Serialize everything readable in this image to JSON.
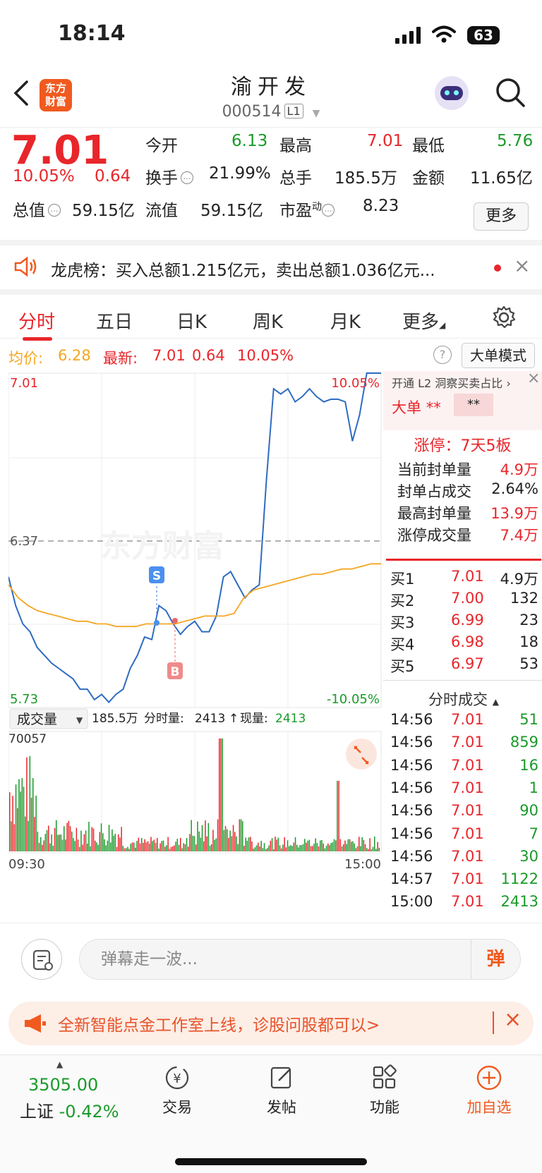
{
  "status_bar": {
    "time": "18:14",
    "battery": "63"
  },
  "header": {
    "logo_line1": "东方",
    "logo_line2": "财富",
    "stock_name": "渝开发",
    "stock_code": "000514",
    "level_badge": "L1"
  },
  "quote": {
    "price": "7.01",
    "change_pct": "10.05%",
    "change": "0.64",
    "open_label": "今开",
    "open": "6.13",
    "high_label": "最高",
    "high": "7.01",
    "low_label": "最低",
    "low": "5.76",
    "turnover_label": "换手",
    "turnover": "21.99%",
    "volume_label": "总手",
    "volume": "185.5万",
    "amount_label": "金额",
    "amount": "11.65亿",
    "mktcap_label": "总值",
    "mktcap": "59.15亿",
    "float_label": "流值",
    "float": "59.15亿",
    "pe_label": "市盈",
    "pe_sup": "动",
    "pe": "8.23",
    "more_button": "更多"
  },
  "news": {
    "text": "龙虎榜：买入总额1.215亿元，卖出总额1.036亿元..."
  },
  "tabs": [
    "分时",
    "五日",
    "日K",
    "周K",
    "月K",
    "更多"
  ],
  "avg_bar": {
    "avg_label": "均价:",
    "avg": "6.28",
    "latest_label": "最新:",
    "latest": "7.01",
    "latest_change": "0.64",
    "latest_pct": "10.05%",
    "mode_button": "大单模式"
  },
  "chart_data": {
    "type": "line",
    "max_label": "7.01",
    "max_pct_label": "10.05%",
    "min_label": "5.73",
    "min_pct_label": "-10.05%",
    "mid_label": "6.37",
    "watermark": "东方财富",
    "marker_s": "S",
    "marker_b": "B",
    "x_start": "09:30",
    "x_end": "15:00",
    "ylim": [
      5.73,
      7.01
    ],
    "series": [
      {
        "values": [
          6.23,
          6.12,
          6.05,
          6.02,
          5.96,
          5.93,
          5.9,
          5.88,
          5.86,
          5.84,
          5.8,
          5.8,
          5.76,
          5.78,
          5.75,
          5.78,
          5.8,
          5.88,
          5.93,
          6.0,
          5.99,
          6.12,
          6.1,
          6.05,
          6.01,
          6.04,
          6.06,
          6.02,
          6.02,
          6.08,
          6.23,
          6.25,
          6.2,
          6.15,
          6.18,
          6.2,
          6.6,
          6.95,
          6.93,
          6.95,
          6.9,
          6.92,
          6.95,
          6.92,
          6.9,
          6.91,
          6.91,
          6.9,
          6.75,
          6.85,
          7.01,
          7.01,
          7.01
        ]
      },
      {
        "values": [
          6.2,
          6.15,
          6.12,
          6.1,
          6.09,
          6.08,
          6.07,
          6.06,
          6.06,
          6.05,
          6.05,
          6.04,
          6.04,
          6.04,
          6.05,
          6.05,
          6.05,
          6.05,
          6.06,
          6.07,
          6.08,
          6.08,
          6.08,
          6.09,
          6.15,
          6.18,
          6.19,
          6.2,
          6.21,
          6.22,
          6.23,
          6.24,
          6.24,
          6.25,
          6.26,
          6.26,
          6.27,
          6.28,
          6.28
        ]
      }
    ],
    "volume": {
      "label": "成交量",
      "total": "185.5万",
      "bar_label": "分时量:",
      "bar_value": "2413",
      "now_label": "现量:",
      "now_value": "2413",
      "max_label": "70057"
    }
  },
  "right_panel": {
    "l2_text": "开通 L2 洞察买卖占比",
    "big_order_label": "大单",
    "big_order_a": "**",
    "big_order_b": "**",
    "limit_up": "涨停：7天5板",
    "stats": [
      {
        "label": "当前封单量",
        "value": "4.9万"
      },
      {
        "label": "封单占成交",
        "value": "2.64%"
      },
      {
        "label": "最高封单量",
        "value": "13.9万"
      },
      {
        "label": "涨停成交量",
        "value": "7.4万"
      }
    ],
    "bids": [
      {
        "label": "买1",
        "price": "7.01",
        "vol": "4.9万"
      },
      {
        "label": "买2",
        "price": "7.00",
        "vol": "132"
      },
      {
        "label": "买3",
        "price": "6.99",
        "vol": "23"
      },
      {
        "label": "买4",
        "price": "6.98",
        "vol": "18"
      },
      {
        "label": "买5",
        "price": "6.97",
        "vol": "53"
      }
    ],
    "ticks_title": "分时成交",
    "ticks": [
      {
        "time": "14:56",
        "price": "7.01",
        "vol": "51"
      },
      {
        "time": "14:56",
        "price": "7.01",
        "vol": "859"
      },
      {
        "time": "14:56",
        "price": "7.01",
        "vol": "16"
      },
      {
        "time": "14:56",
        "price": "7.01",
        "vol": "1"
      },
      {
        "time": "14:56",
        "price": "7.01",
        "vol": "90"
      },
      {
        "time": "14:56",
        "price": "7.01",
        "vol": "7"
      },
      {
        "time": "14:56",
        "price": "7.01",
        "vol": "30"
      },
      {
        "time": "14:57",
        "price": "7.01",
        "vol": "1122"
      },
      {
        "time": "15:00",
        "price": "7.01",
        "vol": "2413"
      }
    ]
  },
  "comment": {
    "placeholder": "弹幕走一波...",
    "send": "弹"
  },
  "promo": {
    "text": "全新智能点金工作室上线，诊股问股都可以>"
  },
  "bottom_nav": {
    "index_value": "3505.00",
    "index_name": "上证",
    "index_change": "-0.42%",
    "items": [
      "交易",
      "发帖",
      "功能",
      "加自选"
    ]
  },
  "colors": {
    "up": "#e8262b",
    "down": "#1a9a2a",
    "avg": "#f5a623",
    "line": "#2f6cc2",
    "brand": "#f05a1f"
  }
}
